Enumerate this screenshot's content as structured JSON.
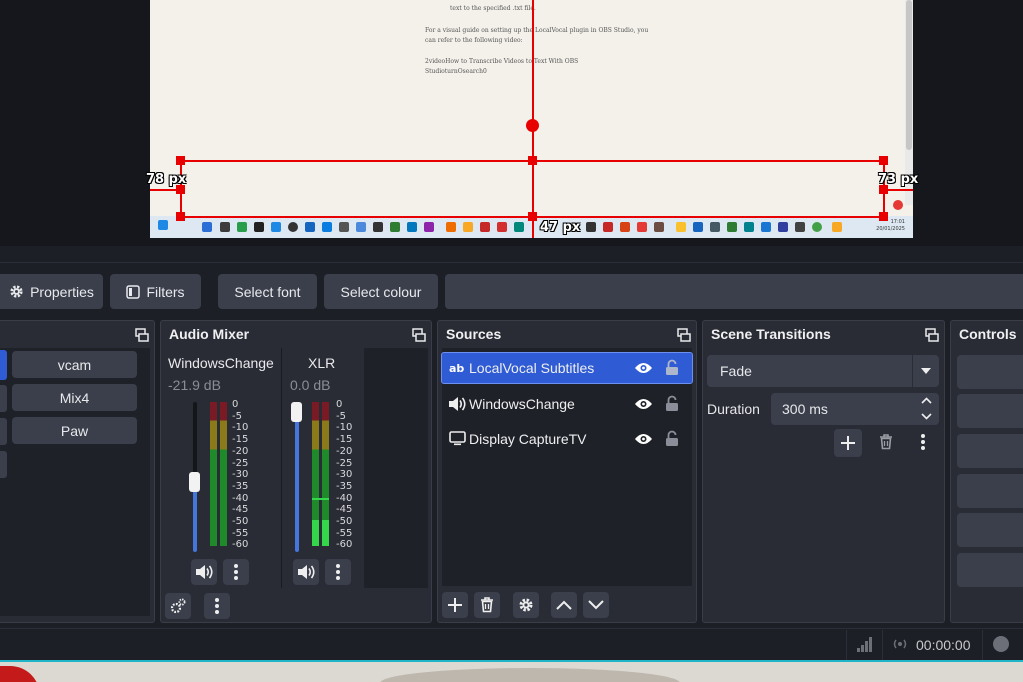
{
  "preview": {
    "doc_lines": [
      "text to the specified .txt file.",
      "For a visual guide on setting up the LocalVocal plugin in OBS Studio, you",
      "can refer to the following video:",
      "2videoHow to Transcribe Videos to Text With OBS",
      "StudioturnOsearch0"
    ],
    "left_distance": "78 px",
    "right_distance": "73 px",
    "bottom_distance": "47 px",
    "taskbar_clock_time": "17:01",
    "taskbar_clock_date": "20/01/2025"
  },
  "toolbar": {
    "properties_label": "Properties",
    "filters_label": "Filters",
    "select_font_label": "Select font",
    "select_colour_label": "Select colour"
  },
  "scenes": {
    "items": [
      "vcam",
      "Mix4",
      "Paw"
    ]
  },
  "audio_mixer": {
    "title": "Audio Mixer",
    "scale": [
      "0",
      "-5",
      "-10",
      "-15",
      "-20",
      "-25",
      "-30",
      "-35",
      "-40",
      "-45",
      "-50",
      "-55",
      "-60"
    ],
    "channels": [
      {
        "name": "WindowsChange",
        "level": "-21.9 dB"
      },
      {
        "name": "XLR",
        "level": "0.0 dB"
      }
    ]
  },
  "sources": {
    "title": "Sources",
    "items": [
      {
        "name": "LocalVocal Subtitles",
        "icon": "text-icon",
        "selected": true
      },
      {
        "name": "WindowsChange",
        "icon": "speaker-icon",
        "selected": false
      },
      {
        "name": "Display CaptureTV",
        "icon": "monitor-icon",
        "selected": false
      }
    ]
  },
  "scene_transitions": {
    "title": "Scene Transitions",
    "transition": "Fade",
    "duration_label": "Duration",
    "duration_value": "300 ms"
  },
  "controls": {
    "title": "Controls"
  },
  "status_bar": {
    "time": "00:00:00"
  },
  "colors": {
    "accent_selected": "#2f5bd4",
    "guide_red": "#e80000",
    "meter_green": "#1f8a2a",
    "meter_yellow": "#8a7a1a",
    "meter_red": "#7a1a24"
  }
}
